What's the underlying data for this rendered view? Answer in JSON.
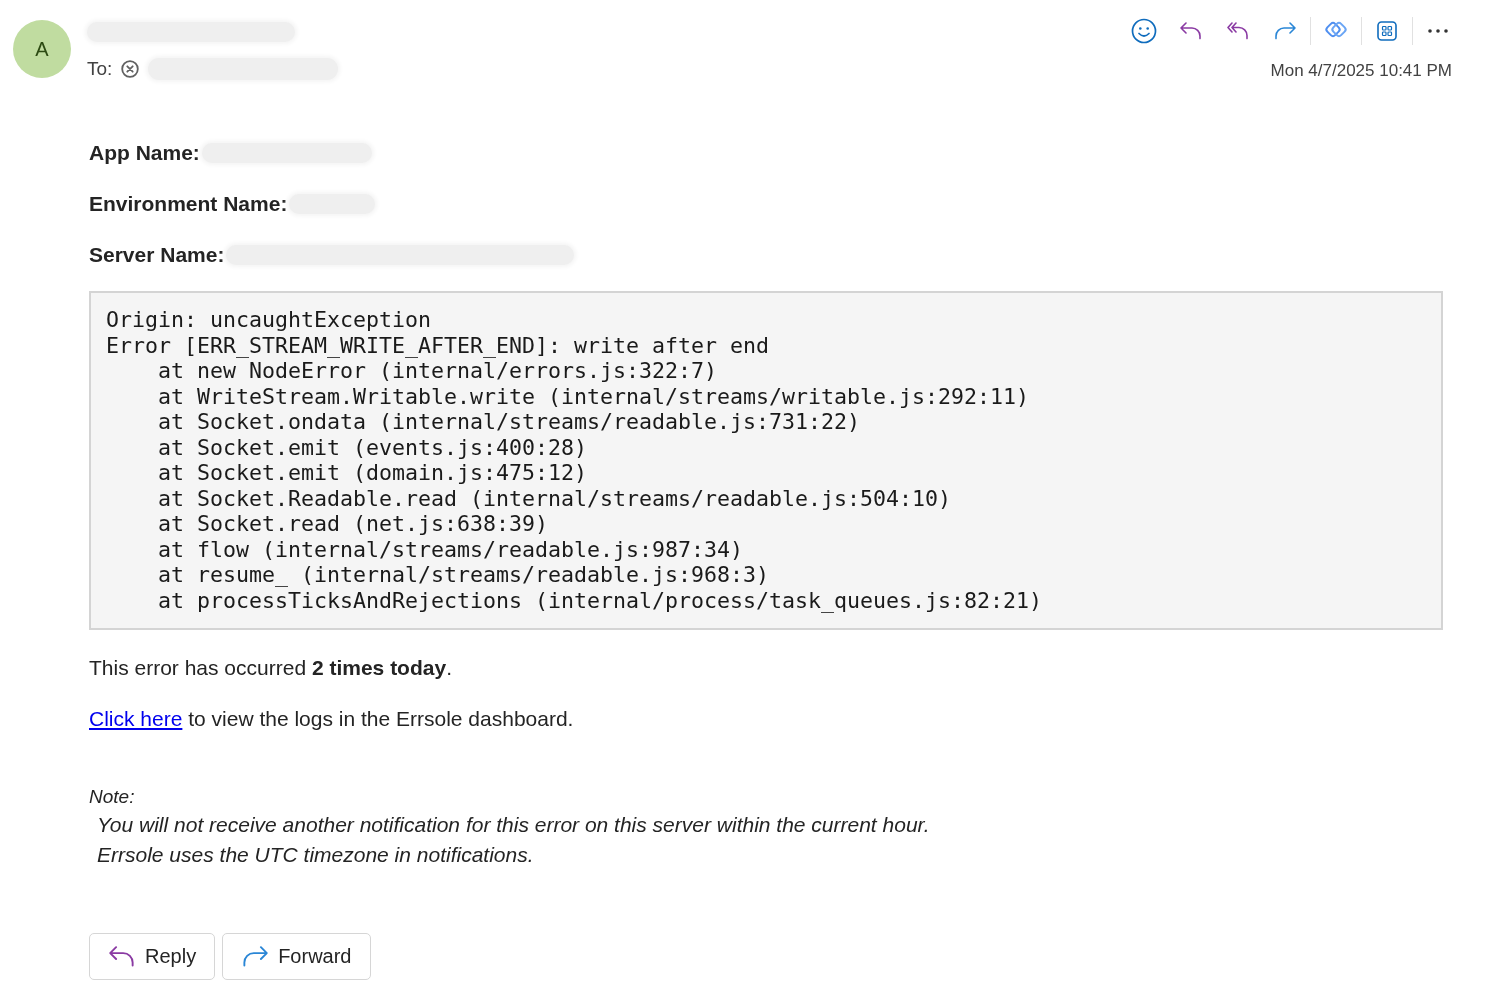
{
  "message": {
    "avatar_initial": "A",
    "to_label": "To:",
    "date": "Mon 4/7/2025 10:41 PM"
  },
  "fields": [
    {
      "label": "App Name:"
    },
    {
      "label": "Environment Name:"
    },
    {
      "label": "Server Name:"
    }
  ],
  "stack_trace": [
    "Origin: uncaughtException",
    "Error [ERR_STREAM_WRITE_AFTER_END]: write after end",
    "    at new NodeError (internal/errors.js:322:7)",
    "    at WriteStream.Writable.write (internal/streams/writable.js:292:11)",
    "    at Socket.ondata (internal/streams/readable.js:731:22)",
    "    at Socket.emit (events.js:400:28)",
    "    at Socket.emit (domain.js:475:12)",
    "    at Socket.Readable.read (internal/streams/readable.js:504:10)",
    "    at Socket.read (net.js:638:39)",
    "    at flow (internal/streams/readable.js:987:34)",
    "    at resume_ (internal/streams/readable.js:968:3)",
    "    at processTicksAndRejections (internal/process/task_queues.js:82:21)"
  ],
  "occurrence": "This error has occurred **2 times today**.",
  "dashboard_line": {
    "link": "Click here",
    "text": "to view the logs in the Errsole dashboard."
  },
  "note": {
    "title": "Note:",
    "lines": [
      "You will not receive another notification for this error on this server within the current hour.",
      "Errsole uses the UTC timezone in notifications."
    ]
  },
  "actions": [
    {
      "kind": "reply",
      "label": "Reply"
    },
    {
      "kind": "forward",
      "label": "Forward"
    }
  ]
}
